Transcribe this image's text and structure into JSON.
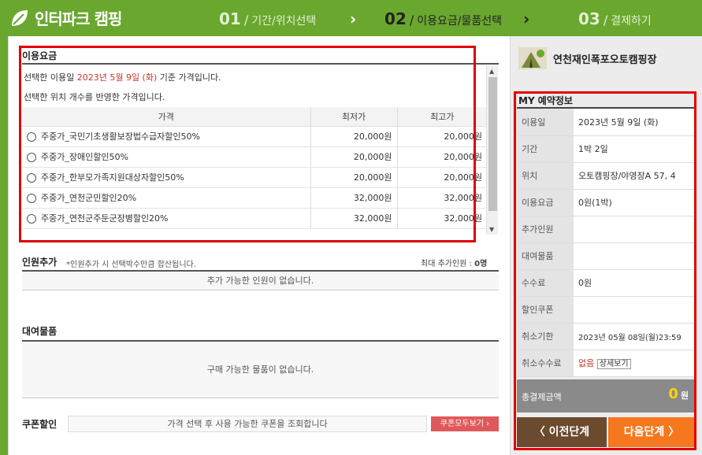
{
  "header": {
    "logo_text": "인터파크 캠핑",
    "steps": [
      {
        "num": "01",
        "label": "기간/위치선택"
      },
      {
        "num": "02",
        "label": "이용요금/물품선택"
      },
      {
        "num": "03",
        "label": "결제하기"
      }
    ],
    "arrow": "›"
  },
  "pricing": {
    "title": "이용요금",
    "desc_prefix": "선택한 이용일 ",
    "date": "2023년 5월 9일 (화)",
    "desc_suffix": " 기준 가격입니다.",
    "desc2": "선택한 위치 개수를 반영한 가격입니다.",
    "columns": [
      "가격",
      "최저가",
      "최고가"
    ],
    "rows": [
      {
        "name": "주중가_국민기초생활보장법수급자할인50%",
        "min": "20,000원",
        "max": "20,000원"
      },
      {
        "name": "주중가_장애인할인50%",
        "min": "20,000원",
        "max": "20,000원"
      },
      {
        "name": "주중가_한부모가족지원대상자할인50%",
        "min": "20,000원",
        "max": "20,000원"
      },
      {
        "name": "주중가_연천군민할인20%",
        "min": "32,000원",
        "max": "32,000원"
      },
      {
        "name": "주중가_연천군주둔군장병할인20%",
        "min": "32,000원",
        "max": "32,000원"
      }
    ]
  },
  "extra_person": {
    "title": "인원추가",
    "note": "*인원추가 시 선택박수만큼 합산됩니다.",
    "max_label": "최대 추가인원 : ",
    "max_value": "0명",
    "empty": "추가 가능한 인원이 없습니다."
  },
  "rental": {
    "title": "대여물품",
    "empty": "구매 가능한 물품이 없습니다."
  },
  "coupon": {
    "title": "쿠폰할인",
    "placeholder": "가격 선택 후 사용 가능한 쿠폰을 조회합니다",
    "button": "쿠폰모두보기 ›"
  },
  "sidebar": {
    "camp_name": "연천재인폭포오토캠핑장",
    "title": "MY 예약정보",
    "items": [
      {
        "k": "이용일",
        "v": "2023년 5월 9일 (화)"
      },
      {
        "k": "기간",
        "v": "1박 2일"
      },
      {
        "k": "위치",
        "v": "오토캠핑장/야영장A 57, 4"
      },
      {
        "k": "이용요금",
        "v": "0원(1박)"
      },
      {
        "k": "추가인원",
        "v": ""
      },
      {
        "k": "대여물품",
        "v": ""
      },
      {
        "k": "수수료",
        "v": "0원"
      },
      {
        "k": "할인쿠폰",
        "v": ""
      },
      {
        "k": "취소기한",
        "v": "2023년 05월 08일(월)23:59"
      },
      {
        "k": "취소수수료",
        "v": "없음"
      }
    ],
    "detail_button": "상세보기",
    "total_label": "총결제금액",
    "total_value": "0",
    "total_unit": "원",
    "prev_button": "〈 이전단계",
    "next_button": "다음단계 〉"
  },
  "colors": {
    "green": "#6aa72f",
    "red_box": "#e00000",
    "orange": "#f5781e",
    "brown": "#6b4a2e",
    "coupon_btn": "#e0595a",
    "total_yellow": "#ffd400"
  }
}
